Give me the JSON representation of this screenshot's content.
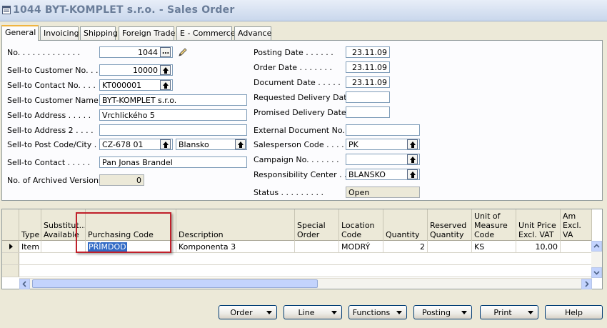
{
  "window": {
    "title": "1044 BYT-KOMPLET s.r.o. - Sales Order"
  },
  "tabs": [
    "General",
    "Invoicing",
    "Shipping",
    "Foreign Trade",
    "E - Commerce",
    "Advance"
  ],
  "left_fields": {
    "no": {
      "label": "No. . . . . . . . . . . . .",
      "value": "1044"
    },
    "sell_to_customer_no": {
      "label": "Sell-to Customer No. . .",
      "value": "10000"
    },
    "sell_to_contact_no": {
      "label": "Sell-to Contact No. . . .",
      "value": "KT000001"
    },
    "sell_to_customer_name": {
      "label": "Sell-to Customer Name .",
      "value": "BYT-KOMPLET s.r.o."
    },
    "sell_to_address": {
      "label": "Sell-to Address . . . . .",
      "value": "Vrchlického 5"
    },
    "sell_to_address2": {
      "label": "Sell-to Address 2 . . . .",
      "value": ""
    },
    "sell_to_post_code_city": {
      "label": "Sell-to Post Code/City . .",
      "post_code": "CZ-678 01",
      "city": "Blansko"
    },
    "sell_to_contact": {
      "label": "Sell-to Contact . . . . .",
      "value": "Pan Jonas Brandel"
    },
    "archived_versions": {
      "label": "No. of Archived Versions.",
      "value": "0"
    }
  },
  "right_fields": {
    "posting_date": {
      "label": "Posting Date . . . . . .",
      "value": "23.11.09"
    },
    "order_date": {
      "label": "Order Date . . . . . . .",
      "value": "23.11.09"
    },
    "document_date": {
      "label": "Document Date . . . . .",
      "value": "23.11.09"
    },
    "requested_delivery_date": {
      "label": "Requested Delivery Date",
      "value": ""
    },
    "promised_delivery_date": {
      "label": "Promised Delivery Date .",
      "value": ""
    },
    "external_document_no": {
      "label": "External Document No. .",
      "value": ""
    },
    "salesperson_code": {
      "label": "Salesperson Code . . . .",
      "value": "PK"
    },
    "campaign_no": {
      "label": "Campaign No. . . . . . .",
      "value": ""
    },
    "responsibility_center": {
      "label": "Responsibility Center . .",
      "value": "BLANSKO"
    },
    "status": {
      "label": "Status . . . . . . . . .",
      "value": "Open"
    }
  },
  "lines": {
    "columns": [
      "Type",
      "Substitut... Available",
      "Purchasing Code",
      "Description",
      "Special Order",
      "Location Code",
      "Quantity",
      "Reserved Quantity",
      "Unit of Measure Code",
      "Unit Price Excl. VAT",
      "Line Am Excl. VA"
    ],
    "rows": [
      {
        "type": "Item",
        "substitution": "",
        "purchasing_code": "PŘÍMDOD",
        "description": "Komponenta 3",
        "special_order": "",
        "location_code": "MODRÝ",
        "quantity": "2",
        "reserved_quantity": "",
        "uom": "KS",
        "unit_price": "10,00",
        "line_amount": ""
      }
    ]
  },
  "buttons": {
    "order": "Order",
    "line": "Line",
    "functions": "Functions",
    "posting": "Posting",
    "print": "Print",
    "help": "Help"
  },
  "icons": {
    "window": "form-icon",
    "edit": "pencil-icon",
    "lookup": "lookup-arrow-icon"
  }
}
